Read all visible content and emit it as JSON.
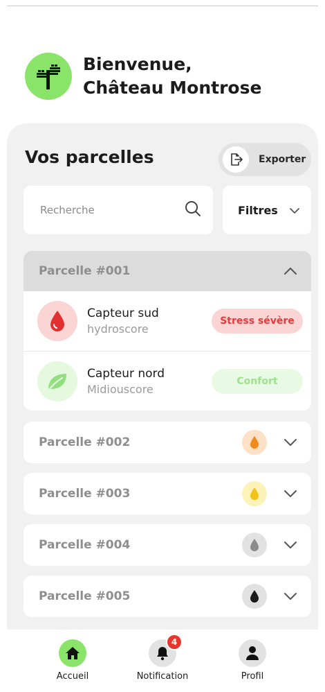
{
  "header": {
    "welcome_line1": "Bienvenue,",
    "welcome_line2": "Château Montrose"
  },
  "panel": {
    "title": "Vos parcelles",
    "export_label": "Exporter",
    "search_placeholder": "Recherche",
    "filter_label": "Filtres"
  },
  "expanded_parcel": {
    "name": "Parcelle #001",
    "sensors": [
      {
        "name": "Capteur sud",
        "score": "hydroscore",
        "status": "Stress sévère",
        "icon": "water-drop-icon",
        "status_color": "#e83a3a",
        "status_bg": "#fbd4d4",
        "icon_bg": "#fbd4d4",
        "icon_color": "#e23030"
      },
      {
        "name": "Capteur nord",
        "score": "Midiouscore",
        "status": "Confort",
        "icon": "leaf-icon",
        "status_color": "#9be38a",
        "status_bg": "#e8fae3",
        "icon_bg": "#e4f9de",
        "icon_color": "#93df7f"
      }
    ]
  },
  "parcels": [
    {
      "name": "Parcelle #002",
      "drop_color": "#f08a1c",
      "dot_bg": "#fde1c6"
    },
    {
      "name": "Parcelle #003",
      "drop_color": "#f2c21a",
      "dot_bg": "#fdf2b8"
    },
    {
      "name": "Parcelle #004",
      "drop_color": "#8c8c8c",
      "dot_bg": "#e2e2e2"
    },
    {
      "name": "Parcelle #005",
      "drop_color": "#1c1c1c",
      "dot_bg": "#e2e2e2"
    }
  ],
  "nav": {
    "home": "Accueil",
    "notification": "Notification",
    "notification_count": "4",
    "profile": "Profil"
  },
  "colors": {
    "accent_green": "#8be46a",
    "badge_red": "#e8362e"
  }
}
